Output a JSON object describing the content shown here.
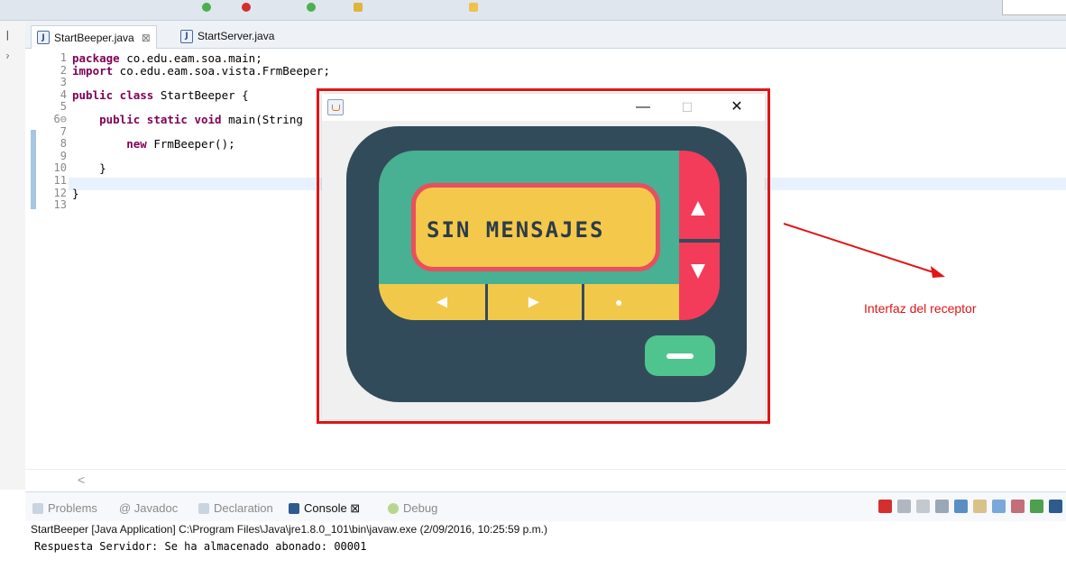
{
  "editor": {
    "tabs": [
      {
        "label": "StartBeeper.java",
        "active": true,
        "close": "⊠"
      },
      {
        "label": "StartServer.java",
        "active": false
      }
    ],
    "line_numbers": [
      "1",
      "2",
      "3",
      "4",
      "5",
      "6⊖",
      "7",
      "8",
      "9",
      "10",
      "11",
      "12",
      "13"
    ],
    "code_lines": [
      {
        "kw": "package",
        "rest": " co.edu.eam.soa.main;"
      },
      {
        "kw": "import",
        "rest": " co.edu.eam.soa.vista.FrmBeeper;"
      },
      {
        "kw": "",
        "rest": ""
      },
      {
        "kw": "public class",
        "rest": " StartBeeper {"
      },
      {
        "kw": "",
        "rest": ""
      },
      {
        "kw": "    public static void",
        "rest": " main(String"
      },
      {
        "kw": "",
        "rest": ""
      },
      {
        "kw": "        new",
        "rest": " FrmBeeper();"
      },
      {
        "kw": "",
        "rest": ""
      },
      {
        "kw": "",
        "rest": "    }"
      },
      {
        "kw": "",
        "rest": ""
      },
      {
        "kw": "",
        "rest": "}"
      },
      {
        "kw": "",
        "rest": ""
      }
    ],
    "scroll_left": "<"
  },
  "beeper_window": {
    "controls": {
      "minimize": "—",
      "maximize": "☐",
      "close": "✕"
    },
    "display_text": "SIN MENSAJES",
    "nav": {
      "left": "◄",
      "right": "►",
      "ok": "●"
    },
    "colors": {
      "body": "#324b5b",
      "panel": "#48b093",
      "display": "#f4c84a",
      "accent": "#f23c5a",
      "button": "#4fc48f"
    }
  },
  "annotation": {
    "text": "Interfaz del receptor",
    "color": "#e01515"
  },
  "console": {
    "tabs": [
      {
        "label": "Problems",
        "icon": "problems-icon"
      },
      {
        "label": "@ Javadoc",
        "icon": "javadoc-icon"
      },
      {
        "label": "Declaration",
        "icon": "declaration-icon"
      },
      {
        "label": "Console ⊠",
        "icon": "console-icon"
      },
      {
        "label": "Debug",
        "icon": "debug-icon"
      }
    ],
    "header": "StartBeeper [Java Application] C:\\Program Files\\Java\\jre1.8.0_101\\bin\\javaw.exe (2/09/2016, 10:25:59 p.m.)",
    "output": "Respuesta Servidor: Se ha almacenado abonado: 00001"
  }
}
